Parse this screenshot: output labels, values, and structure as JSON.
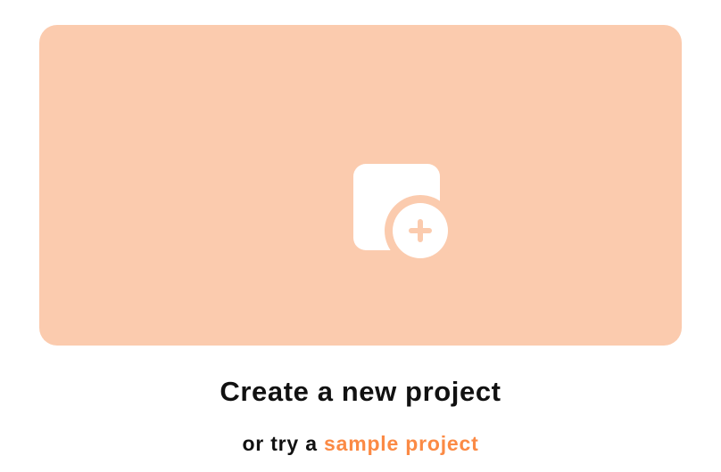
{
  "card": {
    "icon": "add-project-icon",
    "background": "#fbcbae"
  },
  "heading": "Create a new project",
  "subline": {
    "prefix": "or try a ",
    "link_label": "sample project",
    "link_color": "#fb8a45"
  }
}
